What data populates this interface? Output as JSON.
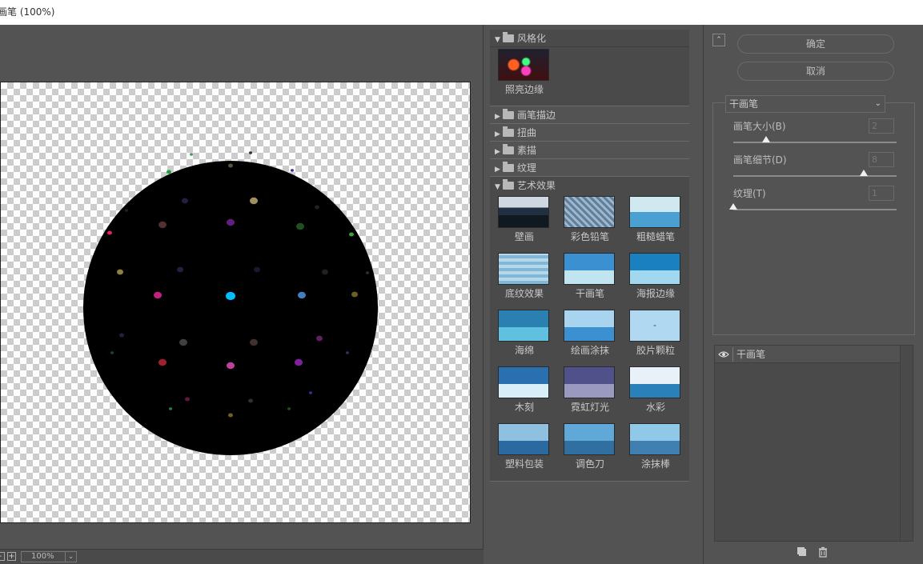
{
  "window": {
    "title": "画笔 (100%)"
  },
  "preview": {
    "zoom_value": "100%",
    "zoom_minus": "-",
    "zoom_plus": "+",
    "zoom_dropdown_icon": "chevron-down-icon"
  },
  "gallery": {
    "categories": [
      {
        "label": "风格化",
        "expanded": true,
        "items": [
          {
            "label": "照亮边缘"
          }
        ]
      },
      {
        "label": "画笔描边",
        "expanded": false
      },
      {
        "label": "扭曲",
        "expanded": false
      },
      {
        "label": "素描",
        "expanded": false
      },
      {
        "label": "纹理",
        "expanded": false
      },
      {
        "label": "艺术效果",
        "expanded": true,
        "items": [
          {
            "label": "壁画"
          },
          {
            "label": "彩色铅笔"
          },
          {
            "label": "粗糙蜡笔"
          },
          {
            "label": "底纹效果"
          },
          {
            "label": "干画笔"
          },
          {
            "label": "海报边缘"
          },
          {
            "label": "海绵"
          },
          {
            "label": "绘画涂抹"
          },
          {
            "label": "胶片颗粒"
          },
          {
            "label": "木刻"
          },
          {
            "label": "霓虹灯光"
          },
          {
            "label": "水彩"
          },
          {
            "label": "塑料包装"
          },
          {
            "label": "调色刀"
          },
          {
            "label": "涂抹棒"
          }
        ]
      }
    ]
  },
  "controls": {
    "ok_label": "确定",
    "cancel_label": "取消",
    "filter_selected": "干画笔",
    "params": [
      {
        "label": "画笔大小(B)",
        "value": "2",
        "slider_fraction": 0.2
      },
      {
        "label": "画笔细节(D)",
        "value": "8",
        "slider_fraction": 0.8
      },
      {
        "label": "纹理(T)",
        "value": "1",
        "slider_fraction": 0.0
      }
    ],
    "layers": [
      {
        "name": "干画笔",
        "visible": true
      }
    ]
  },
  "colors": {
    "accent_dot": "#00bfff",
    "background": "#535353"
  }
}
